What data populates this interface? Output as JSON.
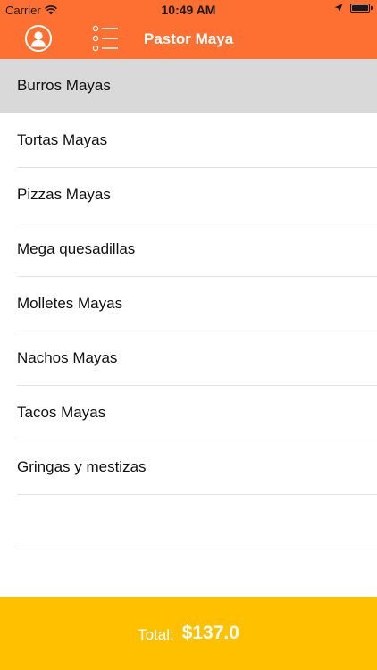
{
  "status_bar": {
    "carrier": "Carrier",
    "time": "10:49 AM"
  },
  "nav": {
    "title": "Pastor Maya"
  },
  "menu": {
    "items": [
      {
        "label": "Burros Mayas",
        "selected": true
      },
      {
        "label": "Tortas Mayas",
        "selected": false
      },
      {
        "label": "Pizzas Mayas",
        "selected": false
      },
      {
        "label": "Mega quesadillas",
        "selected": false
      },
      {
        "label": "Molletes Mayas",
        "selected": false
      },
      {
        "label": "Nachos Mayas",
        "selected": false
      },
      {
        "label": "Tacos Mayas",
        "selected": false
      },
      {
        "label": "Gringas y mestizas",
        "selected": false
      },
      {
        "label": "",
        "selected": false
      }
    ]
  },
  "footer": {
    "total_label": "Total:",
    "total_value": "$137.0"
  },
  "colors": {
    "nav_background": "#fe7032",
    "footer_background": "#ffc000",
    "selected_row": "#d9d9d9"
  },
  "icons": {
    "wifi": "wifi-icon",
    "location": "location-arrow-icon",
    "battery": "battery-icon",
    "profile": "user-profile-icon",
    "menu": "list-menu-icon"
  }
}
